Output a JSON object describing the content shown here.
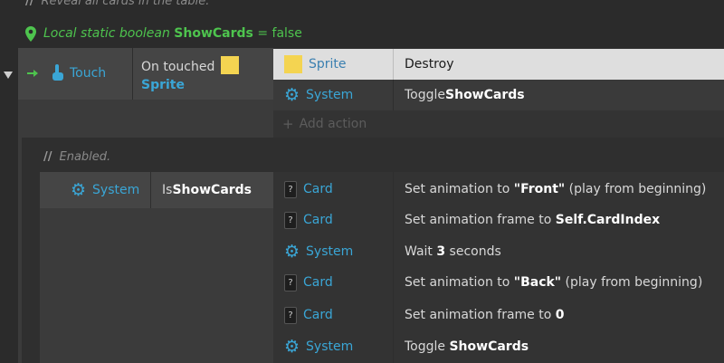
{
  "comment_top": "Reveal all cards in the table.",
  "comment_slashes": "//",
  "local_var": {
    "label": "Local static boolean",
    "name": "ShowCards",
    "assign": "= false"
  },
  "event1": {
    "trigger_label": "Touch",
    "condition_text": "On touched",
    "condition_object": "Sprite",
    "actions": [
      {
        "object": "Sprite",
        "text": "Destroy",
        "bold": "",
        "after": ""
      },
      {
        "object": "System",
        "text": "Toggle ",
        "bold": "ShowCards",
        "after": ""
      }
    ],
    "add_action": "Add action"
  },
  "event2": {
    "comment": "Enabled.",
    "trigger_label": "System",
    "condition_text": "Is ",
    "condition_bold": "ShowCards",
    "actions": [
      {
        "object": "Card",
        "text": "Set animation to ",
        "bold": "\"Front\"",
        "after": " (play from beginning)"
      },
      {
        "object": "Card",
        "text": "Set animation frame to ",
        "bold": "Self.CardIndex",
        "after": ""
      },
      {
        "object": "System",
        "text": "Wait ",
        "bold": "3",
        "after": " seconds"
      },
      {
        "object": "Card",
        "text": "Set animation to ",
        "bold": "\"Back\"",
        "after": " (play from beginning)"
      },
      {
        "object": "Card",
        "text": "Set animation frame to ",
        "bold": "0",
        "after": ""
      },
      {
        "object": "System",
        "text": "Toggle ",
        "bold": "ShowCards",
        "after": ""
      }
    ]
  },
  "colors": {
    "accent_blue": "#3aa6d6",
    "green": "#4ec44e",
    "sprite_yellow": "#f4d451",
    "selected_row": "#dedede"
  },
  "icons": {
    "location": "map-pin-icon",
    "trigger": "arrow-right-icon",
    "touch": "touch-hand-icon",
    "system": "gear-icon",
    "card": "card-icon",
    "collapse": "triangle-down-icon",
    "add": "plus-icon"
  }
}
